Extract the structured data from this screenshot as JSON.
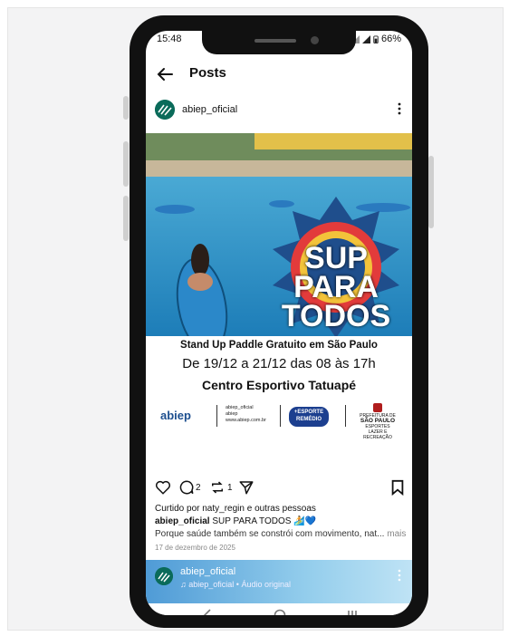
{
  "status": {
    "time": "15:48",
    "battery": "66%"
  },
  "header": {
    "title": "Posts"
  },
  "post": {
    "username": "abiep_oficial",
    "flyer": {
      "logo_text": "SUP PARA TODOS",
      "line1": "Stand Up Paddle Gratuito em São Paulo",
      "line2": "De 19/12 a 21/12 das 08 às 17h",
      "line3": "Centro Esportivo Tatuapé",
      "abiep_logo": "abiep",
      "social": [
        "abiep_oficial",
        "abiep",
        "www.abiep.com.br"
      ],
      "esporte_logo": "+ESPORTE REMÉDIO",
      "prefeitura": {
        "top": "PREFEITURA DE",
        "name": "SÃO PAULO",
        "sub": "ESPORTES",
        "sub2": "LAZER E RECREAÇÃO"
      }
    },
    "comments_count": "2",
    "reposts_count": "1",
    "liked_by": "Curtido por naty_regin e outras pessoas",
    "caption_user": "abiep_oficial",
    "caption_text": "SUP PARA TODOS 🏄💙",
    "caption_line2": "Porque saúde também se constrói com movimento, nat...",
    "more_label": "mais",
    "date": "17 de dezembro de 2025"
  },
  "next_post": {
    "username": "abiep_oficial",
    "audio": "abiep_oficial • Áudio original"
  },
  "colors": {
    "accent": "#1d4f8f",
    "esporte": "#1c3f8f"
  }
}
